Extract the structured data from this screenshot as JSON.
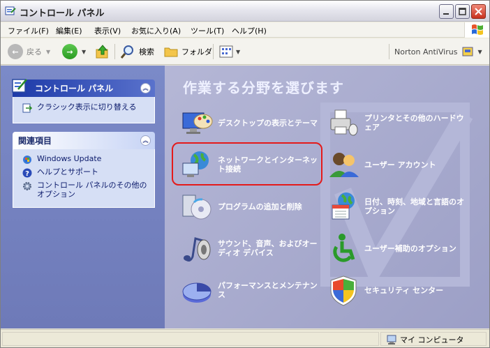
{
  "window": {
    "title": "コントロール パネル"
  },
  "menu": {
    "items": [
      "ファイル(F)",
      "編集(E)",
      "表示(V)",
      "お気に入り(A)",
      "ツール(T)",
      "ヘルプ(H)"
    ]
  },
  "toolbar": {
    "back_label": "戻る",
    "search_label": "検索",
    "folders_label": "フォルダ",
    "norton_label": "Norton AntiVirus"
  },
  "sidebar": {
    "control_panel": {
      "title": "コントロール パネル",
      "switch_label": "クラシック表示に切り替える"
    },
    "related": {
      "title": "関連項目",
      "items": [
        "Windows Update",
        "ヘルプとサポート",
        "コントロール パネルのその他のオプション"
      ]
    }
  },
  "main": {
    "heading": "作業する分野を選びます",
    "categories": [
      {
        "label": "デスクトップの表示とテーマ",
        "icon": "desktop-icon"
      },
      {
        "label": "プリンタとその他のハードウェア",
        "icon": "printer-icon"
      },
      {
        "label": "ネットワークとインターネット接続",
        "icon": "network-icon"
      },
      {
        "label": "ユーザー アカウント",
        "icon": "user-accounts-icon"
      },
      {
        "label": "プログラムの追加と削除",
        "icon": "add-remove-programs-icon"
      },
      {
        "label": "日付、時刻、地域と言語のオプション",
        "icon": "date-time-region-icon"
      },
      {
        "label": "サウンド、音声、およびオーディオ デバイス",
        "icon": "sound-icon"
      },
      {
        "label": "ユーザー補助のオプション",
        "icon": "accessibility-icon"
      },
      {
        "label": "パフォーマンスとメンテナンス",
        "icon": "performance-icon"
      },
      {
        "label": "セキュリティ センター",
        "icon": "security-center-icon"
      }
    ]
  },
  "status": {
    "computer_label": "マイ コンピュータ"
  },
  "colors": {
    "sidebar_bg": "#7b8ac8",
    "content_bg": "#a6a9cc",
    "highlight": "#e41a1a"
  }
}
